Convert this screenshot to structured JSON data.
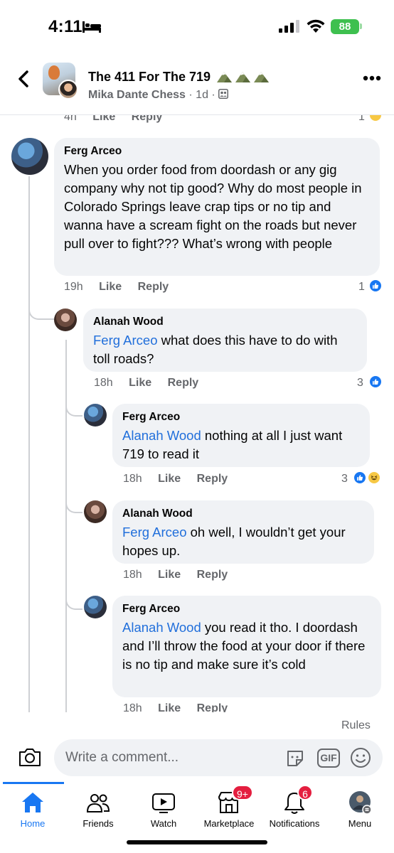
{
  "status_bar": {
    "time": "4:11",
    "battery": "88"
  },
  "header": {
    "group_name": "The 411 For The 719",
    "author": "Mika Dante Chess",
    "age": "1d"
  },
  "top_partial": {
    "time": "4h",
    "like": "Like",
    "reply": "Reply",
    "reaction_count": "1"
  },
  "comments": [
    {
      "author": "Ferg Arceo",
      "text": "When you order food from doordash or any gig company why not tip good? Why do most people in Colorado Springs leave crap tips or no tip and wanna have a scream fight on the roads but never pull over to fight??? What’s wrong with people",
      "time": "19h",
      "like": "Like",
      "reply": "Reply",
      "reactions": "1"
    },
    {
      "author": "Alanah Wood",
      "mention": "Ferg Arceo",
      "text": " what does this have to do with toll roads?",
      "time": "18h",
      "like": "Like",
      "reply": "Reply",
      "reactions": "3"
    },
    {
      "author": "Ferg Arceo",
      "mention": "Alanah Wood",
      "text": " nothing at all I just want 719 to read it",
      "time": "18h",
      "like": "Like",
      "reply": "Reply",
      "reactions": "3"
    },
    {
      "author": "Alanah Wood",
      "mention": "Ferg Arceo",
      "text": " oh well, I wouldn’t get your hopes up.",
      "time": "18h",
      "like": "Like",
      "reply": "Reply"
    },
    {
      "author": "Ferg Arceo",
      "mention": "Alanah Wood",
      "text": " you read it tho. I doordash and I’ll throw the food at your door if there is no tip and make sure it’s cold",
      "time": "18h",
      "like": "Like",
      "reply": "Reply"
    }
  ],
  "composer": {
    "rules": "Rules",
    "placeholder": "Write a comment...",
    "gif": "GIF"
  },
  "tabs": [
    {
      "label": "Home",
      "icon": "home-icon",
      "active": true
    },
    {
      "label": "Friends",
      "icon": "friends-icon"
    },
    {
      "label": "Watch",
      "icon": "watch-icon"
    },
    {
      "label": "Marketplace",
      "icon": "marketplace-icon",
      "badge": "9+"
    },
    {
      "label": "Notifications",
      "icon": "bell-icon",
      "badge": "6"
    },
    {
      "label": "Menu",
      "icon": "menu-avatar-icon"
    }
  ],
  "colors": {
    "accent": "#1877f2",
    "bubble": "#f0f2f5",
    "mention": "#216fdb",
    "badge": "#e41e3f",
    "battery": "#3ec04f"
  }
}
